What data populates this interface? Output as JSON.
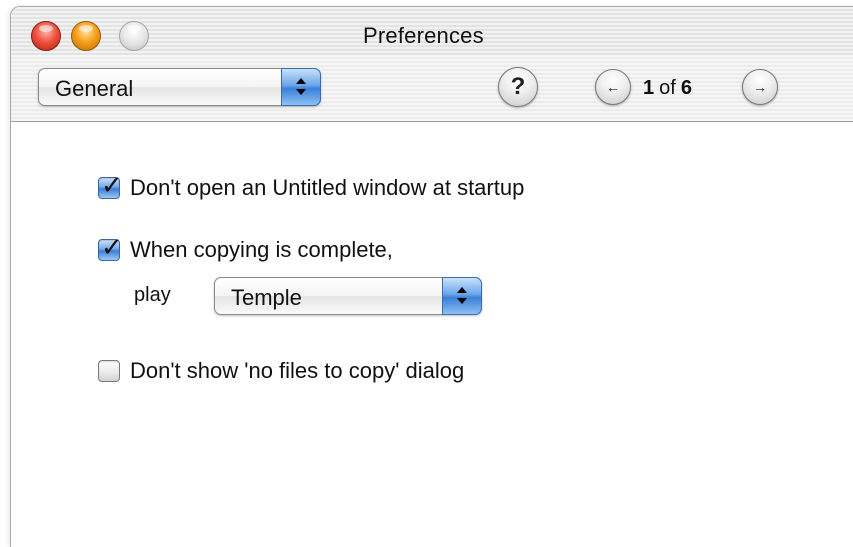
{
  "window": {
    "title": "Preferences"
  },
  "toolbar": {
    "panel_popup": {
      "selected": "General"
    },
    "help_glyph": "?",
    "pager": {
      "current": "1",
      "of_label": "of",
      "total": "6",
      "prev_glyph": "←",
      "next_glyph": "→"
    }
  },
  "preferences": {
    "no_untitled": {
      "label": "Don't open an Untitled window at startup",
      "checked": true
    },
    "copy_complete": {
      "label": "When copying is complete,",
      "checked": true,
      "play_label": "play",
      "sound": "Temple"
    },
    "no_files_dialog": {
      "label": "Don't show 'no files to copy' dialog",
      "checked": false
    }
  },
  "colors": {
    "aqua_blue": "#3b7fd6",
    "close_red": "#f0533f",
    "minimize_yellow": "#f5a11b",
    "zoom_gray": "#e6e6e6"
  }
}
